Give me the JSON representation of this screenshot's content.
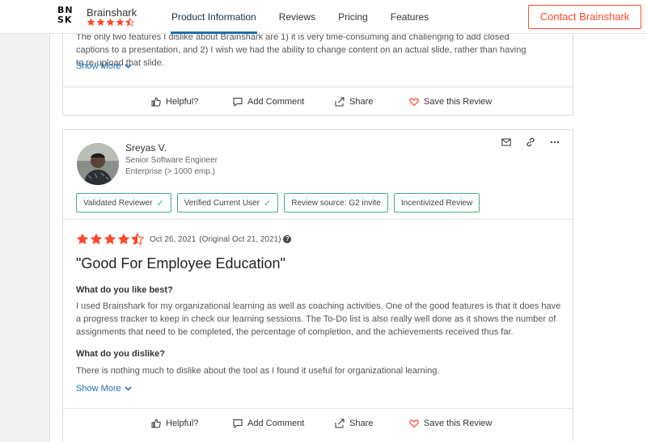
{
  "header": {
    "logo_text": "BN\nSK",
    "brand_name": "Brainshark",
    "brand_rating_stars": 4.5,
    "nav": [
      {
        "label": "Product Information",
        "active": true
      },
      {
        "label": "Reviews",
        "active": false
      },
      {
        "label": "Pricing",
        "active": false
      },
      {
        "label": "Features",
        "active": false
      }
    ],
    "contact_label": "Contact Brainshark",
    "accent_color": "#ff492c"
  },
  "review1": {
    "dislike_text": "The only two features I dislike about Brainshark are 1) it is very time-consuming and challenging to add closed captions to a presentation, and 2) I wish we had the ability to change content on an actual slide, rather than having to re-upload that slide.",
    "show_more": "Show More",
    "actions": {
      "helpful": "Helpful?",
      "comment": "Add Comment",
      "share": "Share",
      "save": "Save this Review"
    }
  },
  "review2": {
    "reviewer_name": "Sreyas V.",
    "reviewer_title": "Senior Software Engineer",
    "company_size": "Enterprise (> 1000 emp.)",
    "badges": [
      {
        "label": "Validated Reviewer",
        "check": true
      },
      {
        "label": "Verified Current User",
        "check": true
      },
      {
        "label": "Review source: G2 invite",
        "check": false
      },
      {
        "label": "Incentivized Review",
        "check": false
      }
    ],
    "rating_stars": 4.5,
    "date": "Oct 26, 2021",
    "original_date": "(Original Oct 21, 2021)",
    "title": "\"Good For Employee Education\"",
    "like_heading": "What do you like best?",
    "like_text": "I used Brainshark for my organizational learning as well as coaching activities. One of the good features is that it does have a progress tracker to keep in check our learning sessions. The To-Do list is also really well done as it shows the number of assignments that need to be completed, the percentage of completion, and the achievements received thus far.",
    "dislike_heading": "What do you dislike?",
    "dislike_text": "There is nothing much to dislike about the tool as I found it useful for organizational learning.",
    "show_more": "Show More",
    "actions": {
      "helpful": "Helpful?",
      "comment": "Add Comment",
      "share": "Share",
      "save": "Save this Review"
    }
  },
  "icons": [
    "brainshark-logo",
    "star-icon",
    "half-star-icon",
    "thumbs-up-icon",
    "comment-icon",
    "share-icon",
    "heart-icon",
    "mail-icon",
    "link-icon",
    "more-icon",
    "chevron-down-icon",
    "check-icon",
    "question-icon"
  ],
  "colors": {
    "star": "#ff492c",
    "link": "#1a6fb4",
    "badge_border": "#46b07d",
    "heart": "#ff492c"
  }
}
